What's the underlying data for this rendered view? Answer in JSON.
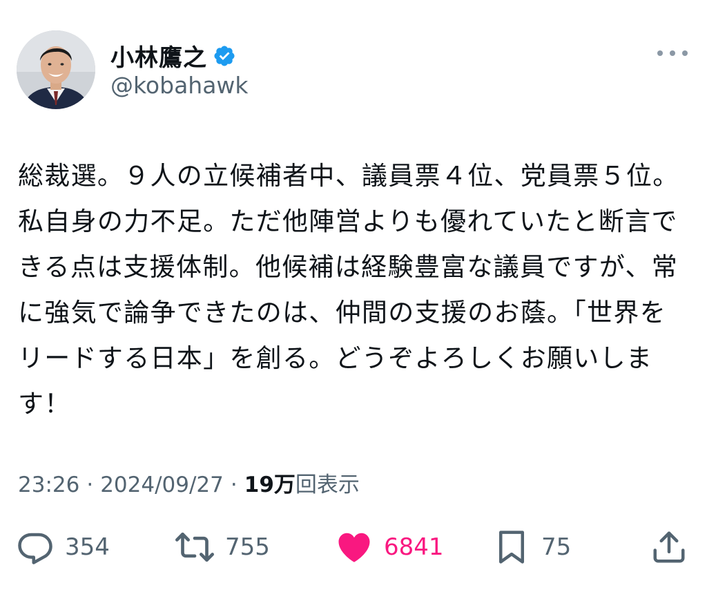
{
  "user": {
    "display_name": "小林鷹之",
    "handle": "@kobahawk",
    "verified": true,
    "avatar_icon": "profile-photo-avatar",
    "verified_icon": "verified-badge-icon"
  },
  "tweet": {
    "text": "総裁選。９人の立候補者中、議員票４位、党員票５位。私自身の力不足。ただ他陣営よりも優れていたと断言できる点は支援体制。他候補は経験豊富な議員ですが、常に強気で論争できたのは、仲間の支援のお蔭。「世界をリードする日本」を創る。どうぞよろしくお願いします！"
  },
  "meta": {
    "time": "23:26",
    "date": "2024/09/27",
    "separator": "·",
    "views_count": "19万",
    "views_label": "回表示"
  },
  "actions": {
    "replies": {
      "icon": "reply-icon",
      "count": "354"
    },
    "reposts": {
      "icon": "repost-icon",
      "count": "755"
    },
    "likes": {
      "icon": "heart-icon",
      "count": "6841",
      "active": true
    },
    "bookmarks": {
      "icon": "bookmark-icon",
      "count": "75"
    },
    "share": {
      "icon": "share-icon"
    }
  },
  "colors": {
    "text": "#0f1419",
    "secondary": "#536471",
    "verified": "#1d9bf0",
    "like": "#f91880",
    "icon": "#536471"
  }
}
